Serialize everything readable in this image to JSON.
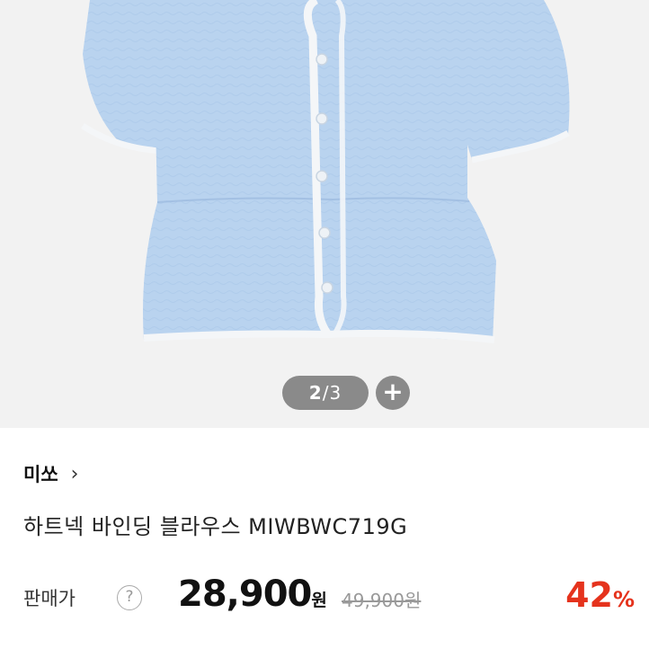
{
  "gallery": {
    "current": "2",
    "separator": "/",
    "total": "3",
    "zoom_label": "+"
  },
  "brand": {
    "name": "미쏘",
    "chevron": "›"
  },
  "product": {
    "title": "하트넥 바인딩 블라우스 MIWBWC719G"
  },
  "pricing": {
    "label": "판매가",
    "help": "?",
    "sale_amount": "28,900",
    "sale_unit": "원",
    "original": "49,900원",
    "discount_value": "42",
    "discount_unit": "%"
  },
  "colors": {
    "blouse": "#b9d3ef",
    "trim": "#f4f6f8",
    "discount": "#e5331d"
  },
  "icons": {
    "brand_chevron": "chevron-right-icon",
    "help": "question-circle-icon",
    "zoom": "plus-icon"
  }
}
